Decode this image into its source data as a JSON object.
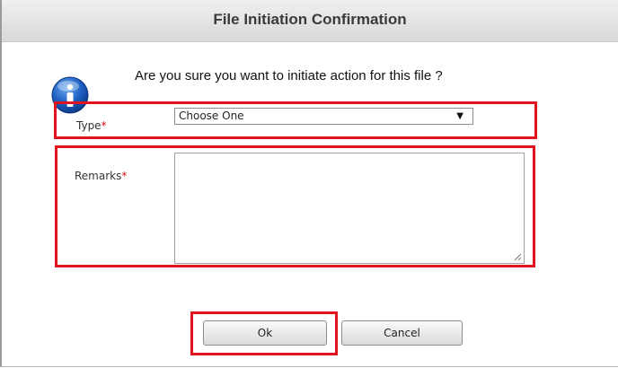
{
  "dialog": {
    "title": "File Initiation Confirmation",
    "question": "Are you sure you want to initiate action for this file ?",
    "icon": "info-icon",
    "accent": "#1d5fc1",
    "highlight_color": "#e0141e"
  },
  "form": {
    "type": {
      "label": "Type",
      "required_mark": "*",
      "selected": "Choose One",
      "arrow": "▼"
    },
    "remarks": {
      "label": "Remarks",
      "required_mark": "*",
      "value": ""
    }
  },
  "buttons": {
    "ok_label": "Ok",
    "cancel_label": "Cancel"
  }
}
